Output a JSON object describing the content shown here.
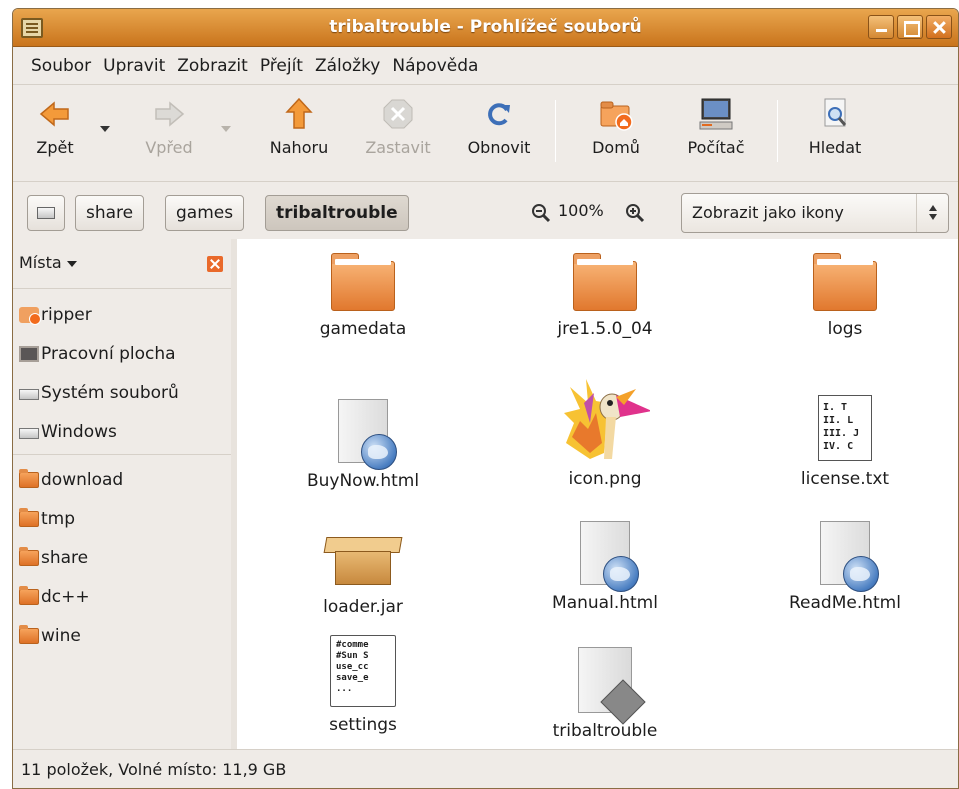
{
  "window": {
    "title": "tribaltrouble - Prohlížeč souborů",
    "accent_color": "#d4822a"
  },
  "menubar": {
    "items": [
      "Soubor",
      "Upravit",
      "Zobrazit",
      "Přejít",
      "Záložky",
      "Nápověda"
    ]
  },
  "toolbar": {
    "back": {
      "label": "Zpět",
      "icon": "arrow-left-icon",
      "enabled": true
    },
    "forward": {
      "label": "Vpřed",
      "icon": "arrow-right-icon",
      "enabled": false
    },
    "up": {
      "label": "Nahoru",
      "icon": "arrow-up-icon",
      "enabled": true
    },
    "stop": {
      "label": "Zastavit",
      "icon": "stop-icon",
      "enabled": false
    },
    "reload": {
      "label": "Obnovit",
      "icon": "reload-icon",
      "enabled": true
    },
    "home": {
      "label": "Domů",
      "icon": "home-folder-icon",
      "enabled": true
    },
    "computer": {
      "label": "Počítač",
      "icon": "computer-icon",
      "enabled": true
    },
    "search": {
      "label": "Hledat",
      "icon": "search-icon",
      "enabled": true
    }
  },
  "location": {
    "breadcrumbs": [
      "share",
      "games",
      "tribaltrouble"
    ],
    "zoom_level": "100%",
    "view_mode": "Zobrazit jako ikony"
  },
  "sidebar": {
    "title": "Místa",
    "places": [
      {
        "label": "ripper",
        "icon": "home-folder-icon"
      },
      {
        "label": "Pracovní plocha",
        "icon": "desktop-icon"
      },
      {
        "label": "Systém souborů",
        "icon": "drive-icon"
      },
      {
        "label": "Windows",
        "icon": "drive-icon"
      }
    ],
    "bookmarks": [
      {
        "label": "download",
        "icon": "folder-icon"
      },
      {
        "label": "tmp",
        "icon": "folder-icon"
      },
      {
        "label": "share",
        "icon": "folder-icon"
      },
      {
        "label": "dc++",
        "icon": "folder-icon"
      },
      {
        "label": "wine",
        "icon": "folder-icon"
      }
    ]
  },
  "files": [
    {
      "name": "gamedata",
      "type": "folder"
    },
    {
      "name": "jre1.5.0_04",
      "type": "folder"
    },
    {
      "name": "logs",
      "type": "folder"
    },
    {
      "name": "BuyNow.html",
      "type": "html"
    },
    {
      "name": "icon.png",
      "type": "image"
    },
    {
      "name": "license.txt",
      "type": "text",
      "preview": [
        "I.   T",
        "II.  L",
        "III. J",
        "IV.  C"
      ]
    },
    {
      "name": "loader.jar",
      "type": "archive"
    },
    {
      "name": "Manual.html",
      "type": "html"
    },
    {
      "name": "ReadMe.html",
      "type": "html"
    },
    {
      "name": "settings",
      "type": "config",
      "preview": [
        "#comme",
        "#Sun S",
        "use_cc",
        "save_e",
        "..."
      ]
    },
    {
      "name": "tribaltrouble",
      "type": "executable"
    }
  ],
  "statusbar": {
    "text": "11 položek, Volné místo: 11,9 GB"
  }
}
